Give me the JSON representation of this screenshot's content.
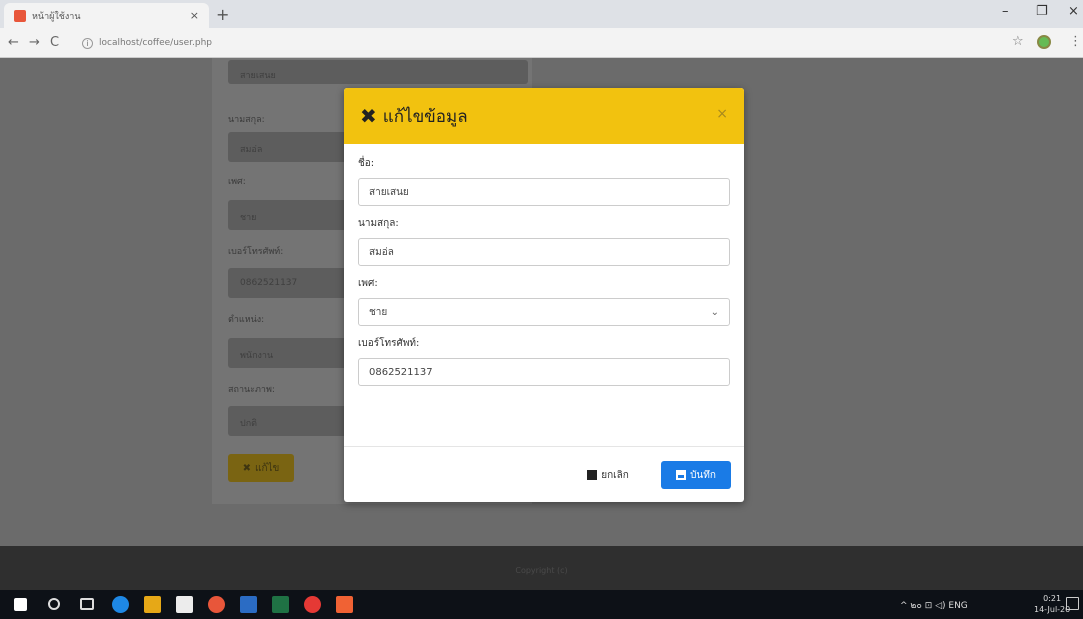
{
  "browser": {
    "tab_title": "หน้าผู้ใช้งาน",
    "tab_close": "×",
    "new_tab": "+",
    "url": "localhost/coffee/user.php",
    "back": "←",
    "forward": "→",
    "reload": "C",
    "info": "i",
    "star": "☆",
    "menu": "⋮",
    "min": "–",
    "max": "❐",
    "close": "×"
  },
  "background_form": {
    "top_value": "สายเสนย",
    "labels": [
      "นามสกุล:",
      "เพศ:",
      "เบอร์โทรศัพท์:",
      "ตำแหน่ง:",
      "สถานะภาพ:"
    ],
    "values": [
      "สมอ่ล",
      "ชาย",
      "0862521137",
      "พนักงาน",
      "ปกติ"
    ],
    "edit_button": "แก้ไข"
  },
  "footer": {
    "text": "Copyright (c)"
  },
  "modal": {
    "title": "แก้ไขข้อมูล",
    "close": "×",
    "fields": [
      {
        "label": "ชื่อ:",
        "value": "สายเสนย"
      },
      {
        "label": "นามสกุล:",
        "value": "สมอ่ล"
      },
      {
        "label": "เพศ:",
        "value": "ชาย"
      },
      {
        "label": "เบอร์โทรศัพท์:",
        "value": "0862521137"
      }
    ],
    "cancel_button": "ยกเลิก",
    "save_button": "บันทึก",
    "chevron": "⌄"
  },
  "taskbar": {
    "tray_text": "^ ๒๐ ⊡ ◁) ENG",
    "time": "0:21",
    "date": "14-Jul-20"
  },
  "colors": {
    "modal_header": "#f2c20f",
    "save_button": "#1a7be6"
  }
}
